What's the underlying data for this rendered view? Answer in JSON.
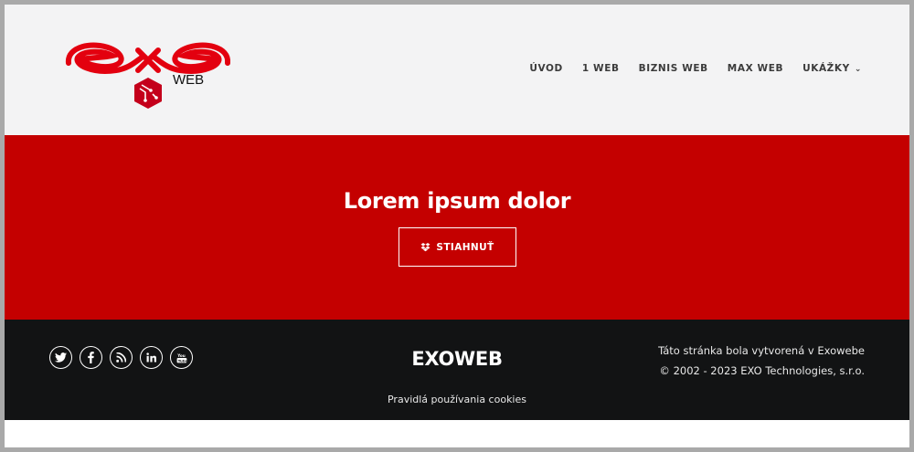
{
  "header": {
    "logo_text": "WEB",
    "nav": [
      {
        "label": "ÚVOD"
      },
      {
        "label": "1 WEB"
      },
      {
        "label": "BIZNIS WEB"
      },
      {
        "label": "MAX WEB"
      },
      {
        "label": "UKÁŽKY",
        "has_dropdown": true
      }
    ]
  },
  "hero": {
    "title": "Lorem ipsum dolor",
    "button_label": "STIAHNUŤ",
    "button_icon": "dropbox-icon",
    "background": "#c40000"
  },
  "footer": {
    "social": [
      {
        "icon": "twitter-icon"
      },
      {
        "icon": "facebook-icon"
      },
      {
        "icon": "rss-icon"
      },
      {
        "icon": "linkedin-icon"
      },
      {
        "icon": "youtube-icon"
      }
    ],
    "brand": "EXOWEB",
    "cookies_link": "Pravidlá používania cookies",
    "credit_line1": "Táto stránka bola vytvorená v Exowebe",
    "credit_line2": "© 2002 - 2023 EXO Technologies, s.r.o.",
    "background": "#121314"
  },
  "colors": {
    "accent": "#c40000",
    "header_bg": "#f3f3f4"
  }
}
